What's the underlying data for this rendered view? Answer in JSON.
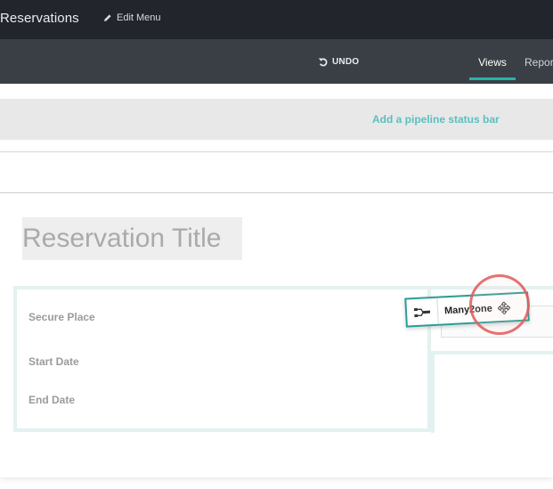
{
  "topbar": {
    "app_title": "Reservations",
    "edit_menu_label": "Edit Menu",
    "edit_icon": "pencil-icon"
  },
  "toolbar": {
    "undo_label": "UNDO",
    "undo_icon": "undo-icon",
    "tabs": [
      {
        "label": "Views",
        "active": true
      },
      {
        "label": "Repor",
        "active": false
      }
    ]
  },
  "pipeline": {
    "link_label": "Add a pipeline status bar"
  },
  "form": {
    "title_placeholder": "Reservation Title",
    "fields": [
      {
        "label": "Secure Place"
      },
      {
        "label": "Start Date"
      },
      {
        "label": "End Date"
      }
    ]
  },
  "drag_widget": {
    "label": "Many2one",
    "icon": "relation-icon",
    "move_icon": "move-cursor-icon"
  },
  "colors": {
    "topbar": "#22262c",
    "subbar": "#3a3f45",
    "accent": "#2ab3a8",
    "link": "#5bbfbf",
    "group_border": "#e2f2f1",
    "click_ring": "#e25a5a"
  }
}
